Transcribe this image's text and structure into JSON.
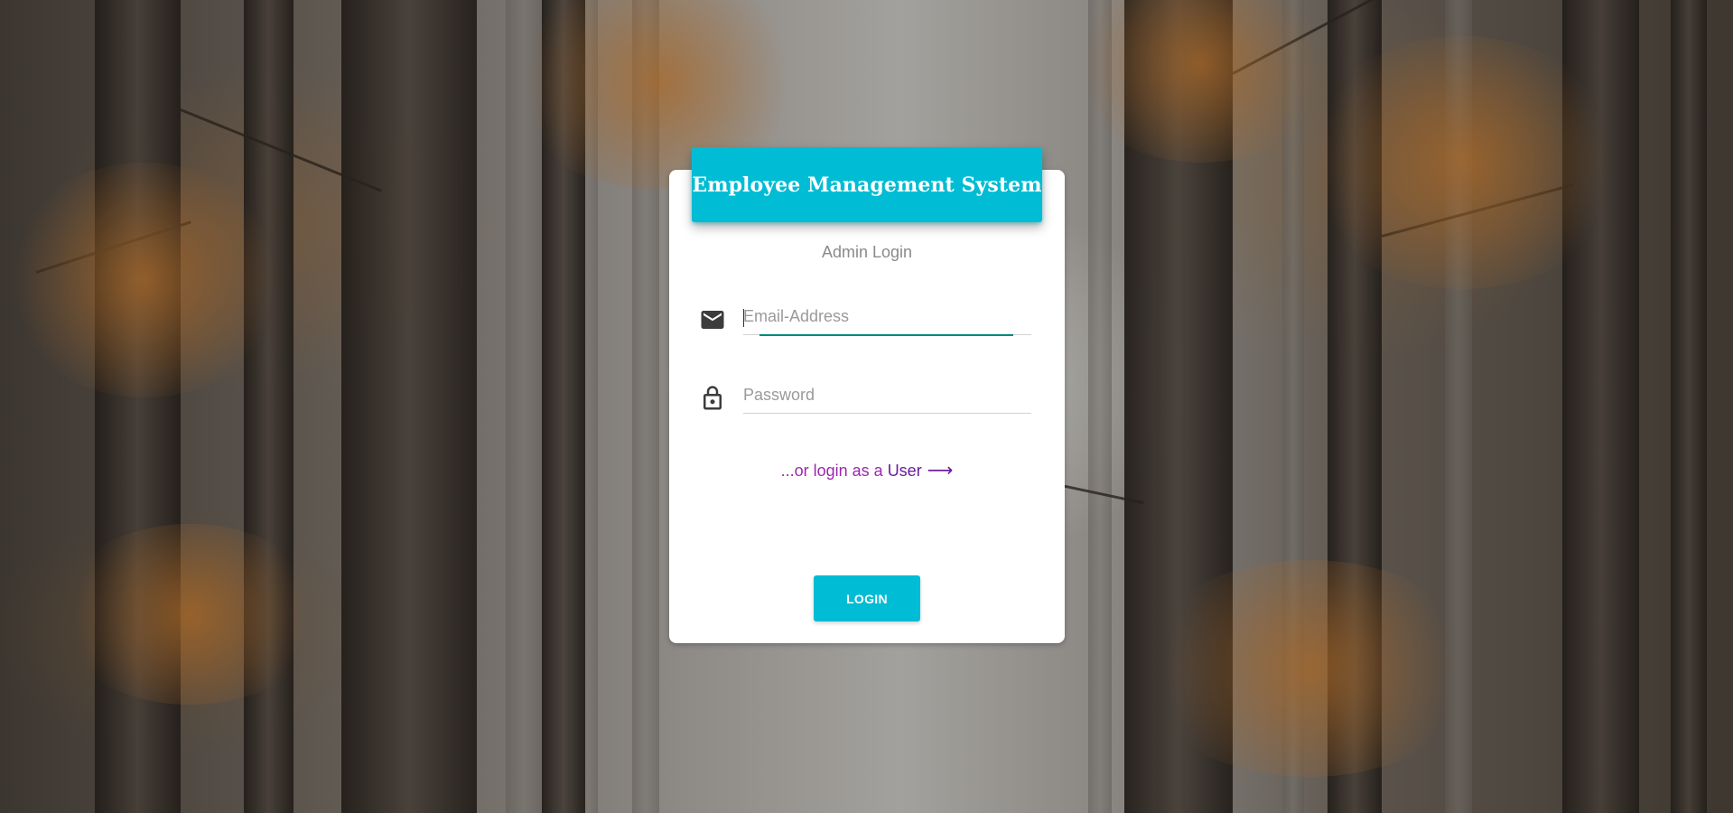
{
  "header": {
    "title": "Employee Management System"
  },
  "subtitle": "Admin Login",
  "email_field": {
    "icon": "mail-icon",
    "placeholder": "Email-Address",
    "value": ""
  },
  "password_field": {
    "icon": "lock-icon",
    "placeholder": "Password",
    "value": ""
  },
  "alt_login": {
    "prefix": "...or login as a",
    "link_label": "User",
    "arrow": "⟶"
  },
  "login_button": {
    "label": "LOGIN"
  },
  "colors": {
    "accent": "#00bcd4",
    "link": "#9c27b0",
    "focus": "#00897b"
  }
}
